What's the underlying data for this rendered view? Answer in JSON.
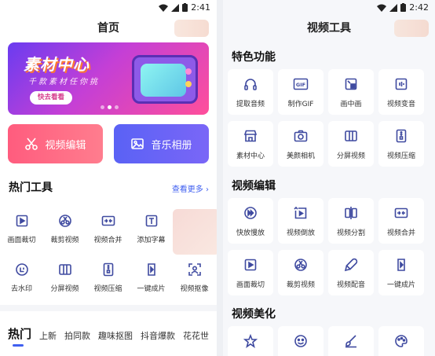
{
  "status_left": {
    "time": "2:41"
  },
  "status_right": {
    "time": "2:42"
  },
  "home": {
    "title": "首页",
    "banner": {
      "title": "素材中心",
      "subtitle": "千款素材任你挑",
      "button": "快去看看",
      "active_dot": 1,
      "dot_count": 3
    },
    "big_buttons": [
      {
        "label": "视频编辑",
        "icon": "scissors-icon"
      },
      {
        "label": "音乐相册",
        "icon": "photo-icon"
      }
    ],
    "hot_tools": {
      "title": "热门工具",
      "more": "查看更多 ›",
      "items": [
        {
          "label": "画面裁切",
          "icon": "crop-icon"
        },
        {
          "label": "裁剪视频",
          "icon": "cut-video-icon"
        },
        {
          "label": "视频合并",
          "icon": "merge-icon"
        },
        {
          "label": "添加字幕",
          "icon": "subtitle-icon"
        },
        {
          "label": "",
          "icon": ""
        },
        {
          "label": "去水印",
          "icon": "watermark-icon"
        },
        {
          "label": "分屏视频",
          "icon": "split-screen-icon"
        },
        {
          "label": "视频压缩",
          "icon": "compress-icon"
        },
        {
          "label": "一键成片",
          "icon": "one-click-icon"
        },
        {
          "label": "视频抠像",
          "icon": "portrait-cutout-icon"
        }
      ]
    },
    "tabs": [
      "热门",
      "上新",
      "拍同款",
      "趣味抠图",
      "抖音爆款",
      "花花世"
    ]
  },
  "tools_page": {
    "title": "视频工具",
    "sections": [
      {
        "title": "特色功能",
        "items": [
          {
            "label": "提取音频",
            "icon": "headphone-icon"
          },
          {
            "label": "制作GIF",
            "icon": "gif-icon"
          },
          {
            "label": "画中画",
            "icon": "picture-in-picture-icon"
          },
          {
            "label": "视频变音",
            "icon": "voice-change-icon"
          },
          {
            "label": "素材中心",
            "icon": "store-icon"
          },
          {
            "label": "美颜相机",
            "icon": "camera-icon"
          },
          {
            "label": "分屏视频",
            "icon": "split-screen-icon"
          },
          {
            "label": "视频压缩",
            "icon": "compress-icon"
          }
        ]
      },
      {
        "title": "视频编辑",
        "items": [
          {
            "label": "快放慢放",
            "icon": "speed-icon"
          },
          {
            "label": "视频倒放",
            "icon": "reverse-icon"
          },
          {
            "label": "视频分割",
            "icon": "split-icon"
          },
          {
            "label": "视频合并",
            "icon": "merge-icon"
          },
          {
            "label": "画面裁切",
            "icon": "crop-icon"
          },
          {
            "label": "裁剪视频",
            "icon": "cut-video-icon"
          },
          {
            "label": "视频配音",
            "icon": "dub-icon"
          },
          {
            "label": "一键成片",
            "icon": "one-click-icon"
          }
        ]
      },
      {
        "title": "视频美化",
        "items": [
          {
            "label": "",
            "icon": "star-icon"
          },
          {
            "label": "",
            "icon": "smile-icon"
          },
          {
            "label": "",
            "icon": "brush-icon"
          },
          {
            "label": "",
            "icon": "palette-icon"
          }
        ]
      }
    ]
  },
  "colors": {
    "accent": "#4060f0",
    "video_btn": "#ff6680",
    "music_btn": "#6a64f6",
    "icon": "#3f4aa0"
  }
}
